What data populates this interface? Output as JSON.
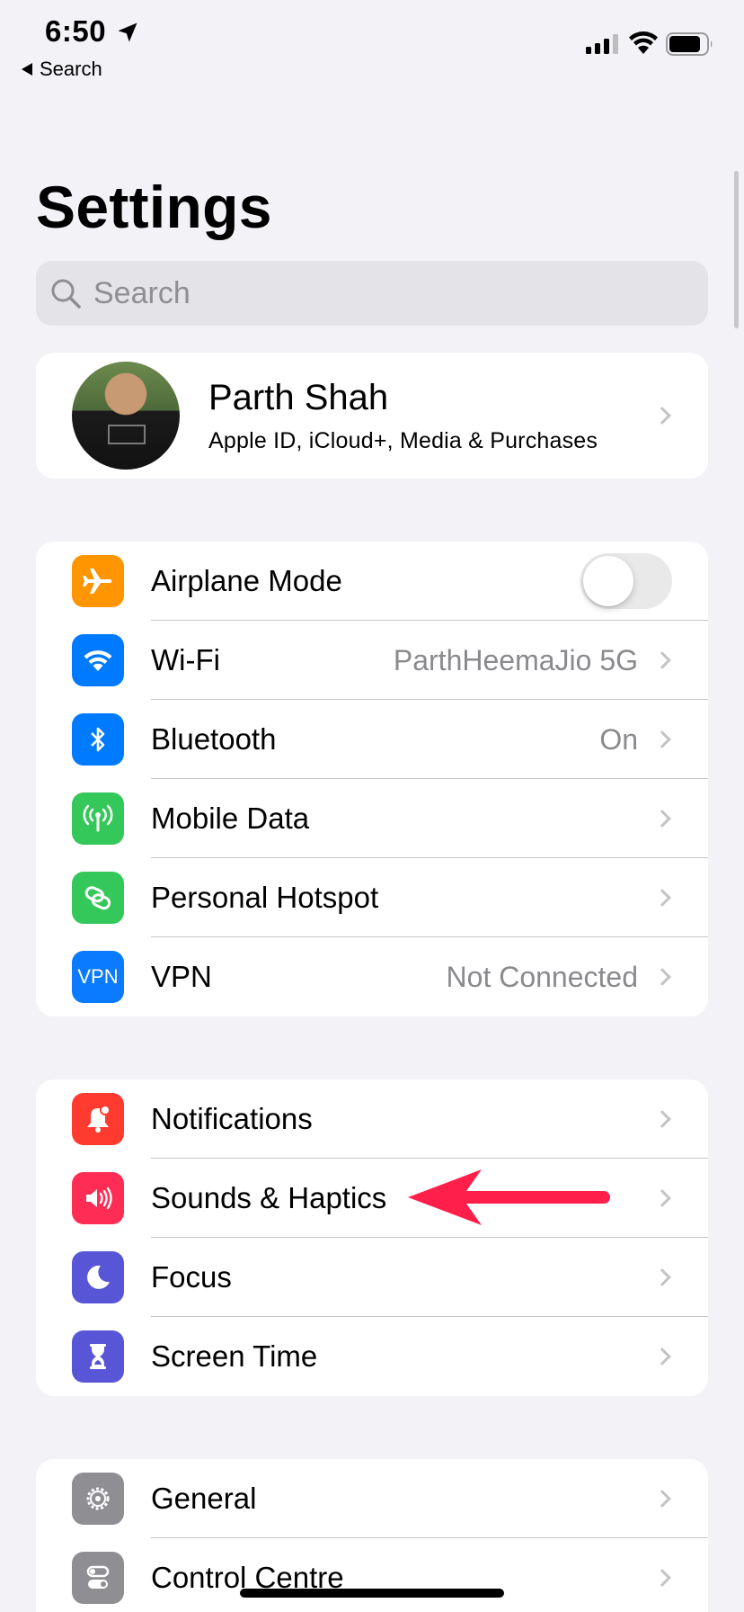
{
  "status_bar": {
    "time": "6:50",
    "back_label": "Search",
    "icons": [
      "location-arrow-icon",
      "cellular-signal-icon",
      "wifi-icon",
      "battery-icon"
    ]
  },
  "page_title": "Settings",
  "search": {
    "placeholder": "Search"
  },
  "profile": {
    "name": "Parth Shah",
    "subtitle": "Apple ID, iCloud+, Media & Purchases"
  },
  "connectivity": [
    {
      "label": "Airplane Mode",
      "icon": "airplane-icon",
      "color": "#ff9500",
      "toggle": false
    },
    {
      "label": "Wi-Fi",
      "icon": "wifi-icon",
      "color": "#007aff",
      "value": "ParthHeemaJio 5G"
    },
    {
      "label": "Bluetooth",
      "icon": "bluetooth-icon",
      "color": "#007aff",
      "value": "On"
    },
    {
      "label": "Mobile Data",
      "icon": "antenna-icon",
      "color": "#34c759"
    },
    {
      "label": "Personal Hotspot",
      "icon": "hotspot-link-icon",
      "color": "#34c759"
    },
    {
      "label": "VPN",
      "icon": "vpn-icon",
      "icon_text": "VPN",
      "color": "#0a7aff",
      "value": "Not Connected"
    }
  ],
  "attention": [
    {
      "label": "Notifications",
      "icon": "notification-bell-icon",
      "color": "#ff3b30"
    },
    {
      "label": "Sounds & Haptics",
      "icon": "speaker-icon",
      "color": "#ff2d55"
    },
    {
      "label": "Focus",
      "icon": "moon-icon",
      "color": "#5856d6"
    },
    {
      "label": "Screen Time",
      "icon": "hourglass-icon",
      "color": "#5856d6"
    }
  ],
  "system": [
    {
      "label": "General",
      "icon": "gear-icon",
      "color": "#8e8e93"
    },
    {
      "label": "Control Centre",
      "icon": "toggles-icon",
      "color": "#8e8e93"
    }
  ],
  "annotation": {
    "icon": "red-arrow-annotation",
    "color": "#ff1f4b"
  }
}
